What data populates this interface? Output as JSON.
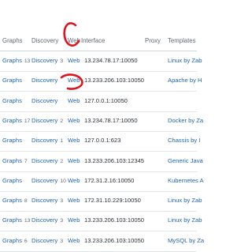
{
  "header": {
    "graphs": "Graphs",
    "discovery": "Discovery",
    "web": "Web",
    "interface": "Interface",
    "proxy": "Proxy",
    "templates": "Templates"
  },
  "rows": [
    {
      "graphs_label": "Graphs",
      "graphs_count": "13",
      "discovery_label": "Discovery",
      "discovery_count": "3",
      "web": "Web",
      "interface": "13.234.78.17:10050",
      "proxy": "",
      "template": "Linux by Zab"
    },
    {
      "graphs_label": "Graphs",
      "graphs_count": "",
      "discovery_label": "Discovery",
      "discovery_count": "",
      "web": "Web",
      "interface": "13.233.206.103:10050",
      "proxy": "",
      "template": "Apache by H"
    },
    {
      "graphs_label": "Graphs",
      "graphs_count": "",
      "discovery_label": "Discovery",
      "discovery_count": "",
      "web": "Web",
      "interface": "127.0.0.1:10050",
      "proxy": "",
      "template": ""
    },
    {
      "graphs_label": "Graphs",
      "graphs_count": "17",
      "discovery_label": "Discovery",
      "discovery_count": "2",
      "web": "Web",
      "interface": "13.234.78.17:10050",
      "proxy": "",
      "template": "Docker by Za"
    },
    {
      "graphs_label": "Graphs",
      "graphs_count": "",
      "discovery_label": "Discovery",
      "discovery_count": "1",
      "web": "Web",
      "interface": "127.0.0.1:623",
      "proxy": "",
      "template": "Chassis by I"
    },
    {
      "graphs_label": "Graphs",
      "graphs_count": "7",
      "discovery_label": "Discovery",
      "discovery_count": "2",
      "web": "Web",
      "interface": "13.233.206.103:12345",
      "proxy": "",
      "template": "Generic Java"
    },
    {
      "graphs_label": "Graphs",
      "graphs_count": "",
      "discovery_label": "Discovery",
      "discovery_count": "10",
      "web": "Web",
      "interface": "172.31.2.16:10050",
      "proxy": "",
      "template": "Kubernetes A"
    },
    {
      "graphs_label": "Graphs",
      "graphs_count": "8",
      "discovery_label": "Discovery",
      "discovery_count": "3",
      "web": "Web",
      "interface": "172.31.10.229:10050",
      "proxy": "",
      "template": "Linux by Zab"
    },
    {
      "graphs_label": "Graphs",
      "graphs_count": "13",
      "discovery_label": "Discovery",
      "discovery_count": "3",
      "web": "Web",
      "interface": "13.233.206.103:10050",
      "proxy": "",
      "template": "Linux by Zab"
    },
    {
      "graphs_label": "Graphs",
      "graphs_count": "6",
      "discovery_label": "Discovery",
      "discovery_count": "3",
      "web": "Web",
      "interface": "13.233.206.103:10050",
      "proxy": "",
      "template": "MySQL by Za"
    }
  ],
  "colors": {
    "link": "#1f65b0",
    "annotation": "#e0141e",
    "header_text": "#5f6a75"
  }
}
